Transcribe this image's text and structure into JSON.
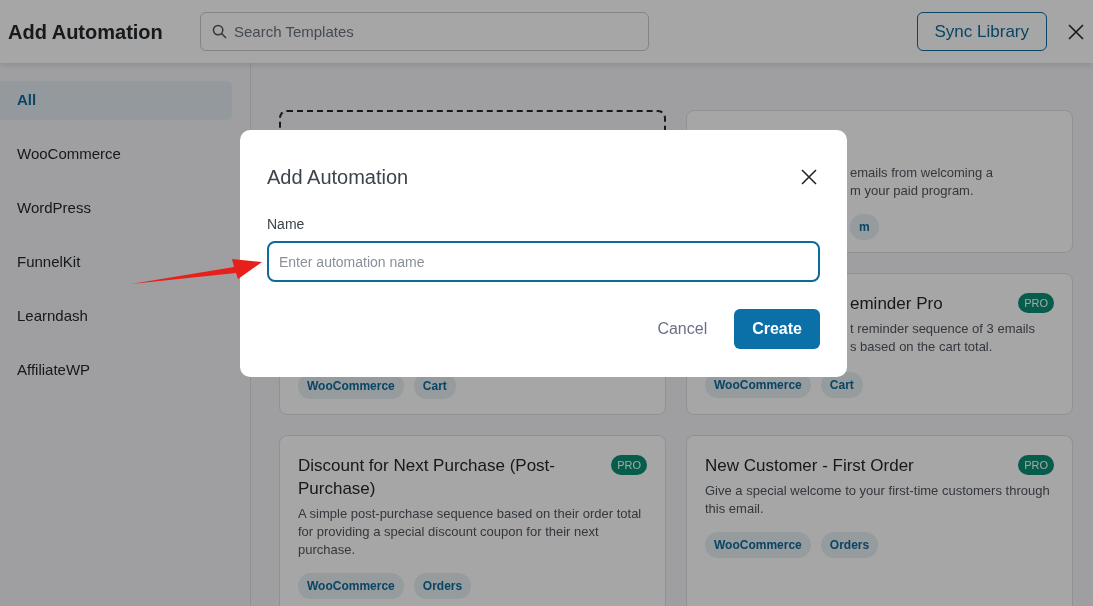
{
  "header": {
    "title": "Add Automation",
    "search": {
      "placeholder": "Search Templates"
    },
    "sync_button": "Sync Library"
  },
  "sidebar": {
    "items": [
      {
        "label": "All",
        "selected": true
      },
      {
        "label": "WooCommerce",
        "selected": false
      },
      {
        "label": "WordPress",
        "selected": false
      },
      {
        "label": "FunnelKit",
        "selected": false
      },
      {
        "label": "Learndash",
        "selected": false
      },
      {
        "label": "AffiliateWP",
        "selected": false
      }
    ]
  },
  "cards": [
    {
      "kind": "dashed"
    },
    {
      "kind": "partial",
      "description_lines": [
        "emails from welcoming a",
        "m your paid program."
      ],
      "tags": [
        "m"
      ]
    },
    {
      "kind": "covered",
      "tags": [
        "WooCommerce",
        "Cart"
      ]
    },
    {
      "kind": "partial",
      "title": "eminder Pro",
      "badge": "PRO",
      "description_lines": [
        "t reminder sequence of 3 emails",
        "s based on the cart total."
      ],
      "tags": [
        "WooCommerce",
        "Cart"
      ]
    },
    {
      "kind": "full",
      "title": "Discount for Next Purchase (Post-Purchase)",
      "badge": "PRO",
      "description": "A simple post-purchase sequence based on their order total for providing a special discount coupon for their next purchase.",
      "tags": [
        "WooCommerce",
        "Orders"
      ]
    },
    {
      "kind": "full",
      "title": "New Customer - First Order",
      "badge": "PRO",
      "description": "Give a special welcome to your first-time customers through this email.",
      "tags": [
        "WooCommerce",
        "Orders"
      ]
    }
  ],
  "modal": {
    "title": "Add Automation",
    "field_label": "Name",
    "placeholder": "Enter automation name",
    "cancel": "Cancel",
    "create": "Create"
  },
  "annotation": {
    "kind": "arrow"
  }
}
